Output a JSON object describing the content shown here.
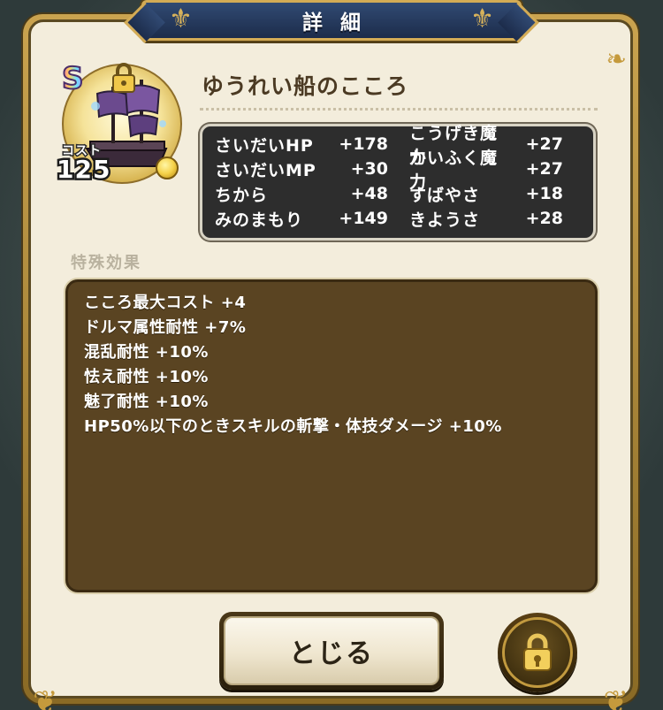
{
  "dialog": {
    "title": "詳細"
  },
  "item": {
    "rank": "S",
    "cost_label": "コスト",
    "cost_value": "125",
    "name": "ゆうれい船のこころ"
  },
  "stats": {
    "rows": [
      {
        "left_name": "さいだいHP",
        "left_value": "+178",
        "right_name": "こうげき魔力",
        "right_value": "+27"
      },
      {
        "left_name": "さいだいMP",
        "left_value": "+30",
        "right_name": "かいふく魔力",
        "right_value": "+27"
      },
      {
        "left_name": "ちから",
        "left_value": "+48",
        "right_name": "すばやさ",
        "right_value": "+18"
      },
      {
        "left_name": "みのまもり",
        "left_value": "+149",
        "right_name": "きようさ",
        "right_value": "+28"
      }
    ]
  },
  "special_effects": {
    "label": "特殊効果",
    "lines": [
      "こころ最大コスト +4",
      "ドルマ属性耐性 +7%",
      "混乱耐性 +10%",
      "怯え耐性 +10%",
      "魅了耐性 +10%",
      "HP50%以下のときスキルの斬撃・体技ダメージ +10%"
    ]
  },
  "buttons": {
    "close_label": "とじる"
  },
  "icons": {
    "ship": "ghost-ship-icon",
    "lock": "padlock-icon",
    "coin": "gold-coin-icon"
  },
  "colors": {
    "frame_gold": "#caa34f",
    "panel_bg": "#f3eddc",
    "header_blue": "#314a73",
    "stats_bg": "#2d2d2d",
    "effects_bg": "#5a4422"
  }
}
